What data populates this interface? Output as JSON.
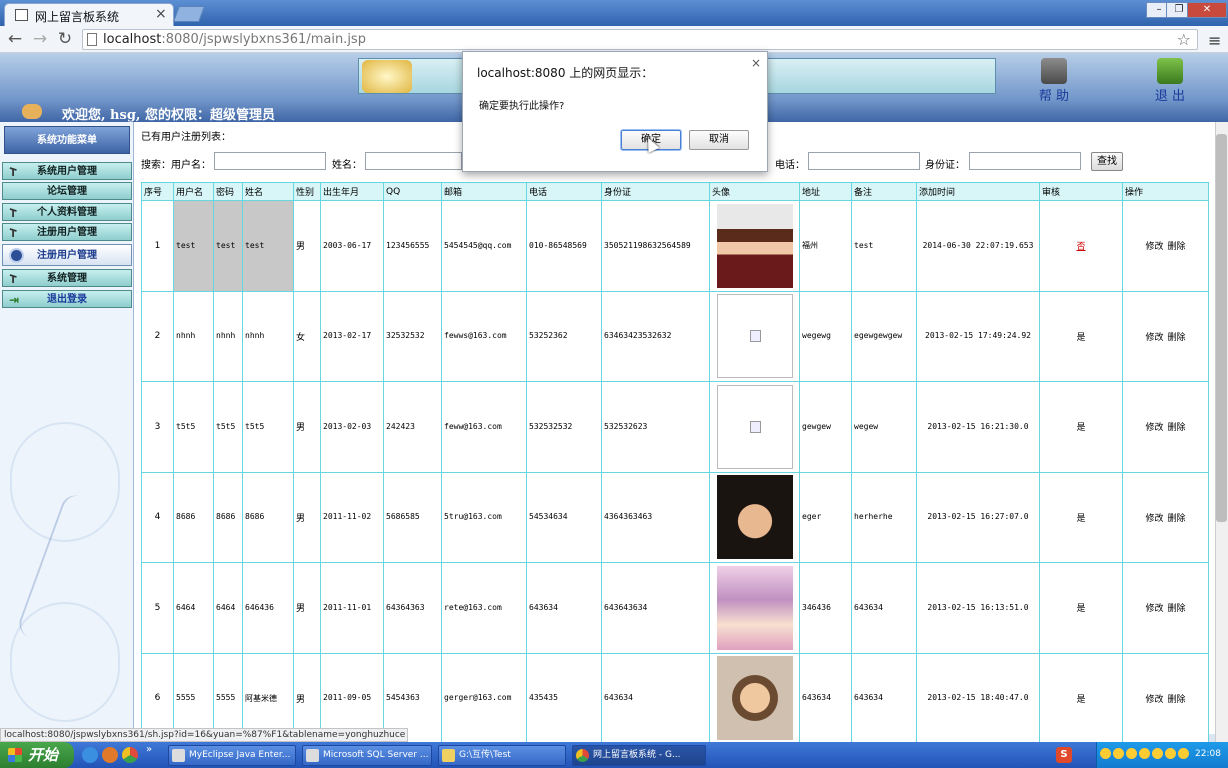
{
  "browser": {
    "tab_title": "网上留言板系统",
    "url_host": "localhost",
    "url_rest": ":8080/jspwslybxns361/main.jsp",
    "status_url": "localhost:8080/jspwslybxns361/sh.jsp?id=16&yuan=%87%F1&tablename=yonghuzhuce"
  },
  "header": {
    "help_label": "帮 助",
    "exit_label": "退 出",
    "welcome": "欢迎您, hsg, 您的权限：超级管理员"
  },
  "sidebar": {
    "menu_title": "系统功能菜单",
    "items": [
      {
        "label": "系统用户管理"
      },
      {
        "label": "论坛管理"
      },
      {
        "label": "个人资料管理"
      },
      {
        "label": "注册用户管理"
      },
      {
        "label": "注册用户管理"
      },
      {
        "label": "系统管理"
      },
      {
        "label": "退出登录"
      }
    ]
  },
  "page": {
    "list_title": "已有用户注册列表：",
    "search": {
      "prefix": "搜索：用户名：",
      "name_label": "姓名：",
      "phone_label": "电话：",
      "idcard_label": "身份证：",
      "button": "查找"
    }
  },
  "table": {
    "headers": [
      "序号",
      "用户名",
      "密码",
      "姓名",
      "性别",
      "出生年月",
      "QQ",
      "邮箱",
      "电话",
      "身份证",
      "头像",
      "地址",
      "备注",
      "添加时间",
      "审核",
      "操作"
    ],
    "rows": [
      {
        "no": "1",
        "username": "test",
        "password": "test",
        "name": "test",
        "gender": "男",
        "birth": "2003-06-17",
        "qq": "123456555",
        "email": "5454545@qq.com",
        "phone": "010-86548569",
        "idcard": "350521198632564589",
        "avatar": "photo-woman",
        "address": "福州",
        "remark": "test",
        "added": "2014-06-30 22:07:19.653",
        "audit": "否",
        "edit": "修改",
        "delete": "删除"
      },
      {
        "no": "2",
        "username": "nhnh",
        "password": "nhnh",
        "name": "nhnh",
        "gender": "女",
        "birth": "2013-02-17",
        "qq": "32532532",
        "email": "fewws@163.com",
        "phone": "53252362",
        "idcard": "63463423532632",
        "avatar": "broken",
        "address": "wegewg",
        "remark": "egewgewgew",
        "added": "2013-02-15 17:49:24.92",
        "audit": "是",
        "edit": "修改",
        "delete": "删除"
      },
      {
        "no": "3",
        "username": "t5t5",
        "password": "t5t5",
        "name": "t5t5",
        "gender": "男",
        "birth": "2013-02-03",
        "qq": "242423",
        "email": "feww@163.com",
        "phone": "532532532",
        "idcard": "532532623",
        "avatar": "broken",
        "address": "gewgew",
        "remark": "wegew",
        "added": "2013-02-15 16:21:30.0",
        "audit": "是",
        "edit": "修改",
        "delete": "删除"
      },
      {
        "no": "4",
        "username": "8686",
        "password": "8686",
        "name": "8686",
        "gender": "男",
        "birth": "2011-11-02",
        "qq": "5686585",
        "email": "5tru@163.com",
        "phone": "54534634",
        "idcard": "4364363463",
        "avatar": "photo-boy",
        "address": "eger",
        "remark": "herherhe",
        "added": "2013-02-15 16:27:07.0",
        "audit": "是",
        "edit": "修改",
        "delete": "删除"
      },
      {
        "no": "5",
        "username": "6464",
        "password": "6464",
        "name": "646436",
        "gender": "男",
        "birth": "2011-11-01",
        "qq": "64364363",
        "email": "rete@163.com",
        "phone": "643634",
        "idcard": "643643634",
        "avatar": "photo-anime",
        "address": "346436",
        "remark": "643634",
        "added": "2013-02-15 16:13:51.0",
        "audit": "是",
        "edit": "修改",
        "delete": "删除"
      },
      {
        "no": "6",
        "username": "5555",
        "password": "5555",
        "name": "阿基米德",
        "gender": "男",
        "birth": "2011-09-05",
        "qq": "5454363",
        "email": "gerger@163.com",
        "phone": "435435",
        "idcard": "643634",
        "avatar": "photo-boy2",
        "address": "643634",
        "remark": "643634",
        "added": "2013-02-15 18:40:47.0",
        "audit": "是",
        "edit": "修改",
        "delete": "删除"
      }
    ]
  },
  "dialog": {
    "title": "localhost:8080 上的网页显示：",
    "message": "确定要执行此操作?",
    "ok": "确定",
    "cancel": "取消"
  },
  "taskbar": {
    "start": "开始",
    "tasks": [
      {
        "label": "MyEclipse Java Enter..."
      },
      {
        "label": "Microsoft SQL Server ..."
      },
      {
        "label": "G:\\互传\\Test"
      },
      {
        "label": "网上留言板系统 - G..."
      }
    ],
    "time": "22:08"
  }
}
